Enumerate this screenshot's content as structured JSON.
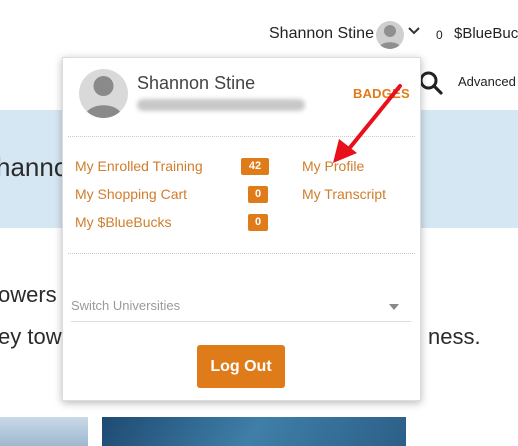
{
  "header": {
    "user_name": "Shannon Stine",
    "bluebucks_count": "0",
    "bluebucks_label": "$BlueBuck",
    "advanced_label": "Advanced"
  },
  "background": {
    "hero_text": "hanno",
    "line1": "owers",
    "line2_start": "ey tow",
    "line2_end": "ness."
  },
  "dropdown": {
    "name": "Shannon Stine",
    "badges_label": "BADGES",
    "links": [
      {
        "label": "My Enrolled Training",
        "count": "42"
      },
      {
        "label": "My Shopping Cart",
        "count": "0"
      },
      {
        "label": "My $BlueBucks",
        "count": "0"
      }
    ],
    "links_right": [
      {
        "label": "My Profile"
      },
      {
        "label": "My Transcript"
      }
    ],
    "switch_placeholder": "Switch Universities",
    "logout_label": "Log Out"
  },
  "colors": {
    "accent": "#e07b1a",
    "link": "#d07d2c",
    "hero_bg": "#d6e7f4",
    "arrow": "#e8101a"
  }
}
